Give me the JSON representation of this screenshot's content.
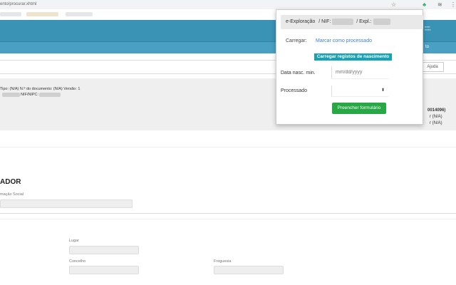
{
  "browser": {
    "url": "ento/procurar.xhtml",
    "star_icon": "star-icon",
    "ext_icon": "extension-icon",
    "menu_icon": "menu-icon"
  },
  "toolbar": {
    "help_label": "Ajuda"
  },
  "info": {
    "line1": "Tipo: (N/A) N.º do documento: (N/A) Versão: 1",
    "line2_label": "NIF/NIPC:",
    "right1": "0014096)",
    "right2": "r (N/A)",
    "right3": "r (N/A)"
  },
  "nav": {
    "right_label": "to"
  },
  "form": {
    "section_title": "ADOR",
    "social_label": "mação Social",
    "lugar_label": "Lugar",
    "concelho_label": "Concelho",
    "freguesia_label": "Freguesia"
  },
  "popup": {
    "breadcrumb_root": "e-Exploração",
    "nif_label": "/ NIF:",
    "expl_label": "/ Expl.:",
    "carregar_label": "Carregar:",
    "mark_processed_link": "Marcar como processado",
    "load_births_button": "Carregar registos de nascimento",
    "date_label": "Data nasc. min.",
    "date_placeholder": "mm/dd/yyyy",
    "processed_label": "Processado",
    "processed_value": "",
    "fill_form_button": "Preencher formulário"
  }
}
